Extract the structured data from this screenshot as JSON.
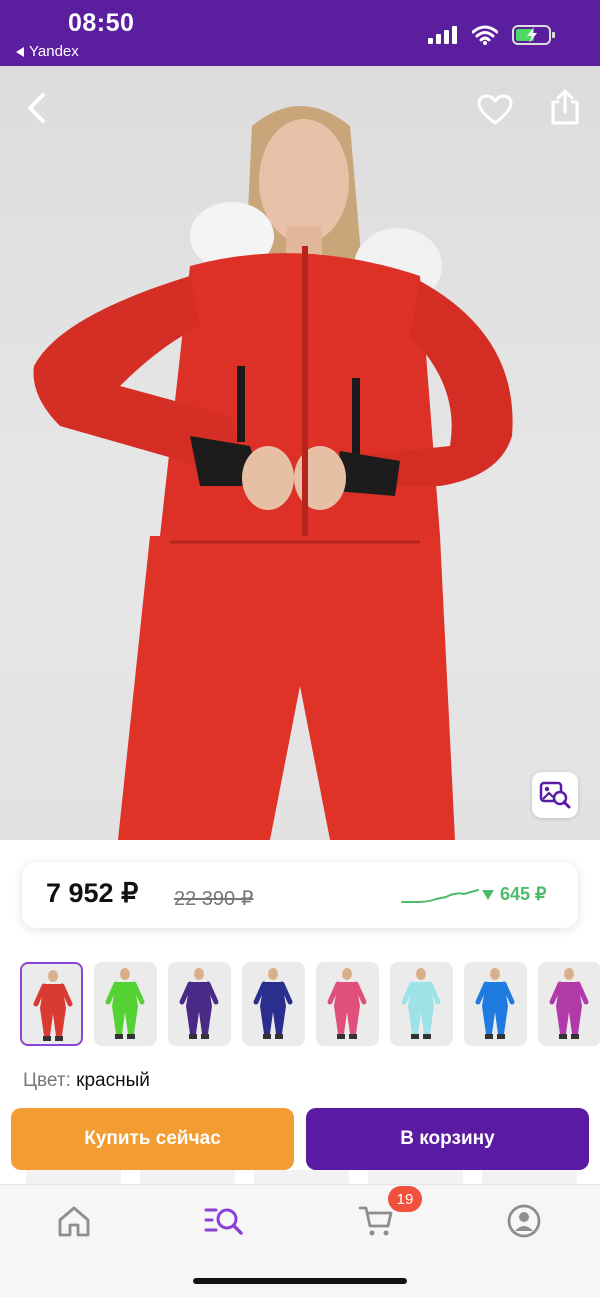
{
  "status_bar": {
    "time": "08:50",
    "back_app": "Yandex"
  },
  "product": {
    "price": "7 952 ₽",
    "old_price": "22 390 ₽",
    "price_drop": "645 ₽",
    "color_label": "Цвет:",
    "color_value": "красный",
    "variants": [
      {
        "color": "#d93a32"
      },
      {
        "color": "#55d233"
      },
      {
        "color": "#4a2a86"
      },
      {
        "color": "#2a2f8e"
      },
      {
        "color": "#e0507a"
      },
      {
        "color": "#9ce2e6"
      },
      {
        "color": "#1f7be0"
      },
      {
        "color": "#b23aa8"
      }
    ]
  },
  "actions": {
    "buy_now": "Купить сейчас",
    "add_to_cart": "В корзину"
  },
  "tabbar": {
    "cart_badge": "19"
  },
  "colors": {
    "brand": "#5b1e9e",
    "accent_orange": "#f39c32",
    "cart_purple": "#5b1aa3",
    "drop_green": "#4cbb6a",
    "badge_red": "#f0503c"
  }
}
